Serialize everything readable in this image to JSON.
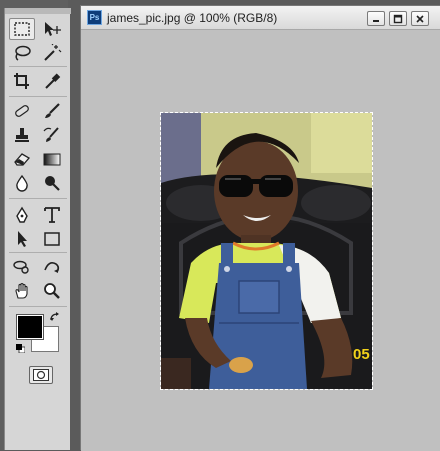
{
  "document": {
    "app_badge": "Ps",
    "title": "james_pic.jpg @ 100% (RGB/8)",
    "minimize_icon": "minimize-icon",
    "maximize_icon": "maximize-icon",
    "close_icon": "close-icon"
  },
  "photo": {
    "date_stamp": "05"
  },
  "toolbox": {
    "tools": [
      "rectangular-marquee-tool",
      "move-tool",
      "lasso-tool",
      "magic-wand-tool",
      "crop-tool",
      "eyedropper-tool",
      "healing-brush-tool",
      "brush-tool",
      "clone-stamp-tool",
      "history-brush-tool",
      "eraser-tool",
      "gradient-tool",
      "blur-tool",
      "dodge-tool",
      "pen-tool",
      "type-tool",
      "path-selection-tool",
      "rectangle-tool",
      "3d-rotate-tool",
      "3d-orbit-tool",
      "hand-tool",
      "zoom-tool"
    ],
    "active_tool": "rectangular-marquee-tool",
    "foreground_color": "#000000",
    "background_color": "#ffffff"
  },
  "colors": {
    "workspace_bg": "#c0c0c0",
    "panel_bg": "#d6d6d6",
    "titlebar": "#e6e6e6"
  }
}
